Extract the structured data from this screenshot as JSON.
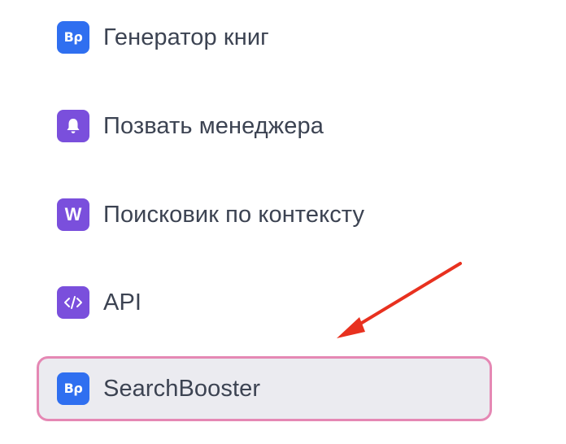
{
  "menu": {
    "items": [
      {
        "label": "Генератор книг",
        "icon": "bo-logo-icon",
        "icon_text": "Bρ",
        "icon_color": "#2f6ff0"
      },
      {
        "label": "Позвать менеджера",
        "icon": "bell-icon",
        "icon_color": "#7a4fdc"
      },
      {
        "label": "Поисковик по контексту",
        "icon": "w-letter-icon",
        "icon_text": "W",
        "icon_color": "#7a4fdc"
      },
      {
        "label": "API",
        "icon": "code-icon",
        "icon_color": "#7a4fdc"
      },
      {
        "label": "SearchBooster",
        "icon": "bo-logo-icon",
        "icon_text": "Bρ",
        "icon_color": "#2f6ff0",
        "highlighted": true
      }
    ]
  },
  "annotation": {
    "arrow_color": "#e8311f",
    "highlight_border_color": "#e588b4"
  }
}
